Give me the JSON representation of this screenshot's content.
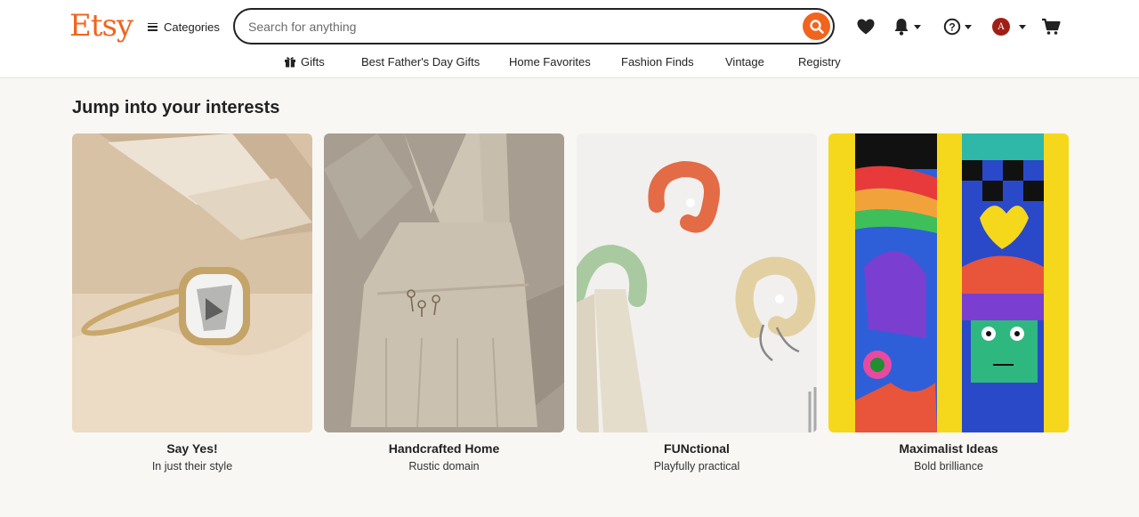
{
  "header": {
    "logo": "Etsy",
    "categories_label": "Categories",
    "search": {
      "placeholder": "Search for anything",
      "value": ""
    },
    "icons": {
      "search": "search-icon",
      "favorites": "heart-icon",
      "notifications": "bell-icon",
      "help": "help-icon",
      "cart": "cart-icon"
    },
    "avatar_initial": "A"
  },
  "nav": {
    "items": [
      {
        "label": "Gifts",
        "icon": "gift-icon"
      },
      {
        "label": "Best Father's Day Gifts"
      },
      {
        "label": "Home Favorites"
      },
      {
        "label": "Fashion Finds"
      },
      {
        "label": "Vintage"
      },
      {
        "label": "Registry"
      }
    ]
  },
  "main": {
    "section_title": "Jump into your interests",
    "cards": [
      {
        "title": "Say Yes!",
        "subtitle": "In just their style"
      },
      {
        "title": "Handcrafted Home",
        "subtitle": "Rustic domain"
      },
      {
        "title": "FUNctional",
        "subtitle": "Playfully practical"
      },
      {
        "title": "Maximalist Ideas",
        "subtitle": "Bold brilliance"
      }
    ]
  },
  "colors": {
    "brand": "#f1641e",
    "avatar": "#a01f14",
    "text": "#222222",
    "background": "#f8f7f4"
  }
}
